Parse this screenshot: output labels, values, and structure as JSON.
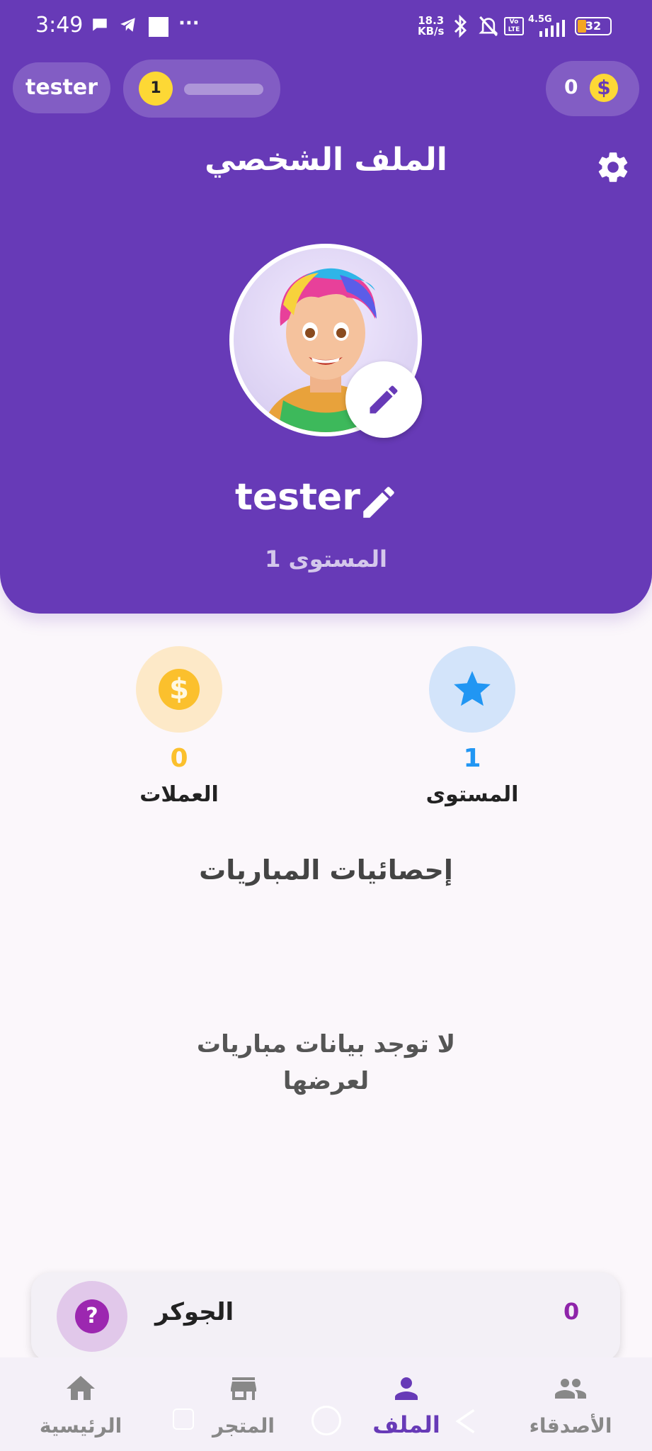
{
  "status_bar": {
    "time": "3:49",
    "net_speed_value": "18.3",
    "net_speed_unit": "KB/s",
    "network": "4.5G",
    "volte": "Vo LTE",
    "battery": "32"
  },
  "top_bar": {
    "username": "tester",
    "level": "1",
    "xp_progress": 0.0,
    "coins": "0"
  },
  "header": {
    "title": "الملف الشخصي",
    "username": "tester",
    "level_label": "المستوى 1"
  },
  "stats": {
    "level_value": "1",
    "level_label": "المستوى",
    "coins_value": "0",
    "coins_label": "العملات"
  },
  "match_stats": {
    "title": "إحصائيات المباريات",
    "empty_message": "لا توجد بيانات مباريات لعرضها"
  },
  "joker": {
    "name": "الجوكر",
    "count": "0"
  },
  "bottom_nav": {
    "items": [
      {
        "label": "الرئيسية",
        "icon": "home-icon"
      },
      {
        "label": "المتجر",
        "icon": "store-icon"
      },
      {
        "label": "الملف",
        "icon": "person-icon"
      },
      {
        "label": "الأصدقاء",
        "icon": "people-icon"
      }
    ],
    "active": 2
  },
  "colors": {
    "primary": "#673ab7",
    "gold": "#fdd835",
    "blue": "#2196f3",
    "joker": "#9c27b0"
  }
}
